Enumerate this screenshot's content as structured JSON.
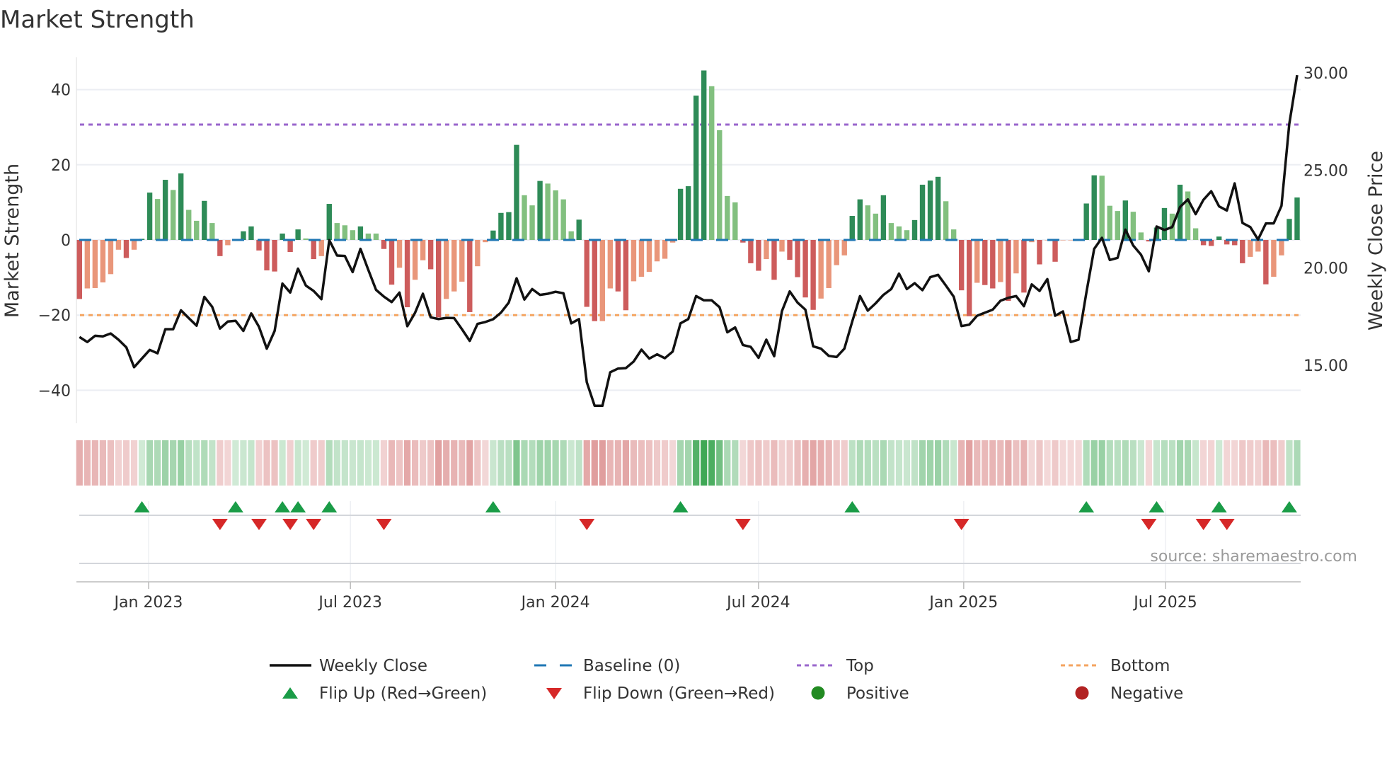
{
  "title": "Market Strength",
  "source": "source: sharemaestro.com",
  "colors": {
    "pos_strong": "#2e8b57",
    "pos_weak": "#82c07f",
    "neg_strong": "#cd5c5c",
    "neg_weak": "#e9967a",
    "baseline": "#1f77b4",
    "top": "#9966cc",
    "bottom": "#f4a460",
    "close": "#111111",
    "flip_up": "#1a9c47",
    "flip_down": "#d62828",
    "positive": "#228b22",
    "negative": "#b22222"
  },
  "legend": {
    "weekly_close": "Weekly Close",
    "baseline": "Baseline (0)",
    "top": "Top",
    "bottom": "Bottom",
    "flip_up": "Flip Up (Red→Green)",
    "flip_down": "Flip Down (Green→Red)",
    "positive": "Positive",
    "negative": "Negative"
  },
  "chart_data": {
    "type": "bar",
    "title": "Market Strength",
    "ylabel": "Market Strength",
    "y2label": "Weekly Close Price",
    "ylim": [
      -48.5,
      49
    ],
    "y2lim": [
      11.9,
      31.2
    ],
    "start_date": "2022-10-31",
    "interval": "weekly",
    "y_ticks": [
      {
        "value": 40,
        "label": "40"
      },
      {
        "value": 20,
        "label": "20"
      },
      {
        "value": 0,
        "label": "0"
      },
      {
        "value": -20,
        "label": "−20"
      },
      {
        "value": -40,
        "label": "−40"
      }
    ],
    "y2_ticks": [
      {
        "value": 30,
        "label": "30.00"
      },
      {
        "value": 25,
        "label": "25.00"
      },
      {
        "value": 20,
        "label": "20.00"
      },
      {
        "value": 15,
        "label": "15.00"
      }
    ],
    "x_ticks": [
      {
        "date": "2023-01-01",
        "label": "Jan 2023"
      },
      {
        "date": "2023-07-01",
        "label": "Jul 2023"
      },
      {
        "date": "2024-01-01",
        "label": "Jan 2024"
      },
      {
        "date": "2024-07-01",
        "label": "Jul 2024"
      },
      {
        "date": "2025-01-01",
        "label": "Jan 2025"
      },
      {
        "date": "2025-07-01",
        "label": "Jul 2025"
      }
    ],
    "reference_lines": {
      "baseline": 0,
      "top": 30.7,
      "bottom": -20
    },
    "series": [
      {
        "name": "Market Strength",
        "type": "bar",
        "values": [
          -15.7,
          -12.9,
          -12.8,
          -11.3,
          -9.1,
          -2.6,
          -4.8,
          -2.6,
          0.3,
          12.6,
          10.9,
          16.0,
          13.3,
          17.7,
          8.0,
          5.1,
          10.4,
          4.5,
          -4.3,
          -1.4,
          0.2,
          2.3,
          3.6,
          -2.8,
          -8.1,
          -8.4,
          1.7,
          -3.2,
          2.8,
          0.4,
          -5.1,
          -4.3,
          9.6,
          4.5,
          3.9,
          2.6,
          3.6,
          1.7,
          1.7,
          -2.4,
          -11.9,
          -7.4,
          -17.9,
          -10.6,
          -5.4,
          -7.8,
          -20.6,
          -15.7,
          -13.7,
          -11.1,
          -19.2,
          -7.0,
          -0.6,
          2.5,
          7.2,
          7.4,
          25.3,
          11.9,
          9.2,
          15.7,
          15.0,
          13.2,
          10.8,
          2.3,
          5.4,
          -17.8,
          -21.6,
          -21.6,
          -12.9,
          -13.7,
          -18.7,
          -11.0,
          -9.8,
          -8.5,
          -5.7,
          -5.0,
          -0.7,
          13.6,
          14.3,
          38.4,
          45.1,
          40.9,
          29.2,
          11.7,
          10.0,
          -0.7,
          -6.2,
          -8.2,
          -5.1,
          -10.6,
          -3.1,
          -5.3,
          -9.9,
          -15.3,
          -18.6,
          -15.6,
          -12.8,
          -6.7,
          -4.1,
          6.4,
          10.8,
          9.2,
          7.0,
          11.9,
          4.5,
          3.6,
          2.6,
          5.3,
          14.7,
          15.8,
          16.8,
          10.3,
          2.8,
          -13.4,
          -20.3,
          -11.4,
          -12.0,
          -12.9,
          -11.2,
          -16.2,
          -8.9,
          -14.0,
          -0.6,
          -6.5,
          -0.1,
          -5.8,
          -0.1,
          -0.1,
          -0.1,
          9.7,
          17.2,
          17.1,
          9.1,
          7.7,
          10.5,
          7.5,
          2.0,
          -0.4,
          3.3,
          8.5,
          7.0,
          14.7,
          12.9,
          3.1,
          -1.4,
          -1.6,
          0.9,
          -1.2,
          -1.4,
          -6.2,
          -4.5,
          -3.1,
          -11.8,
          -9.8,
          -4.1,
          5.6,
          11.3
        ]
      },
      {
        "name": "Weekly Close",
        "type": "line",
        "axis": "right",
        "values": [
          16.45,
          16.19,
          16.51,
          16.48,
          16.63,
          16.31,
          15.92,
          14.9,
          15.34,
          15.79,
          15.61,
          16.85,
          16.85,
          17.82,
          17.42,
          17.03,
          18.51,
          18.0,
          16.88,
          17.24,
          17.28,
          16.76,
          17.66,
          16.97,
          15.85,
          16.76,
          19.19,
          18.73,
          19.96,
          19.09,
          18.81,
          18.39,
          21.42,
          20.63,
          20.61,
          19.78,
          20.97,
          19.9,
          18.87,
          18.52,
          18.24,
          18.73,
          17.0,
          17.7,
          18.67,
          17.46,
          17.37,
          17.43,
          17.42,
          16.85,
          16.25,
          17.12,
          17.22,
          17.36,
          17.7,
          18.21,
          19.46,
          18.37,
          18.91,
          18.61,
          18.67,
          18.77,
          18.69,
          17.15,
          17.37,
          14.13,
          12.92,
          12.92,
          14.64,
          14.83,
          14.85,
          15.19,
          15.8,
          15.34,
          15.56,
          15.36,
          15.7,
          17.15,
          17.37,
          18.55,
          18.33,
          18.33,
          17.98,
          16.69,
          16.94,
          16.04,
          15.94,
          15.38,
          16.31,
          15.46,
          17.78,
          18.79,
          18.21,
          17.85,
          15.97,
          15.85,
          15.48,
          15.42,
          15.85,
          17.24,
          18.55,
          17.8,
          18.18,
          18.61,
          18.91,
          19.7,
          18.91,
          19.21,
          18.85,
          19.52,
          19.64,
          19.09,
          18.52,
          17.01,
          17.08,
          17.54,
          17.7,
          17.85,
          18.31,
          18.46,
          18.55,
          18.03,
          19.15,
          18.81,
          19.42,
          17.54,
          17.76,
          16.19,
          16.31,
          18.73,
          20.97,
          21.54,
          20.4,
          20.51,
          21.96,
          21.15,
          20.67,
          19.82,
          22.12,
          21.94,
          22.09,
          23.12,
          23.51,
          22.75,
          23.49,
          23.93,
          23.15,
          22.94,
          24.33,
          22.3,
          22.09,
          21.45,
          22.28,
          22.28,
          23.18,
          27.38,
          29.89
        ]
      }
    ],
    "legend_position": "bottom"
  }
}
